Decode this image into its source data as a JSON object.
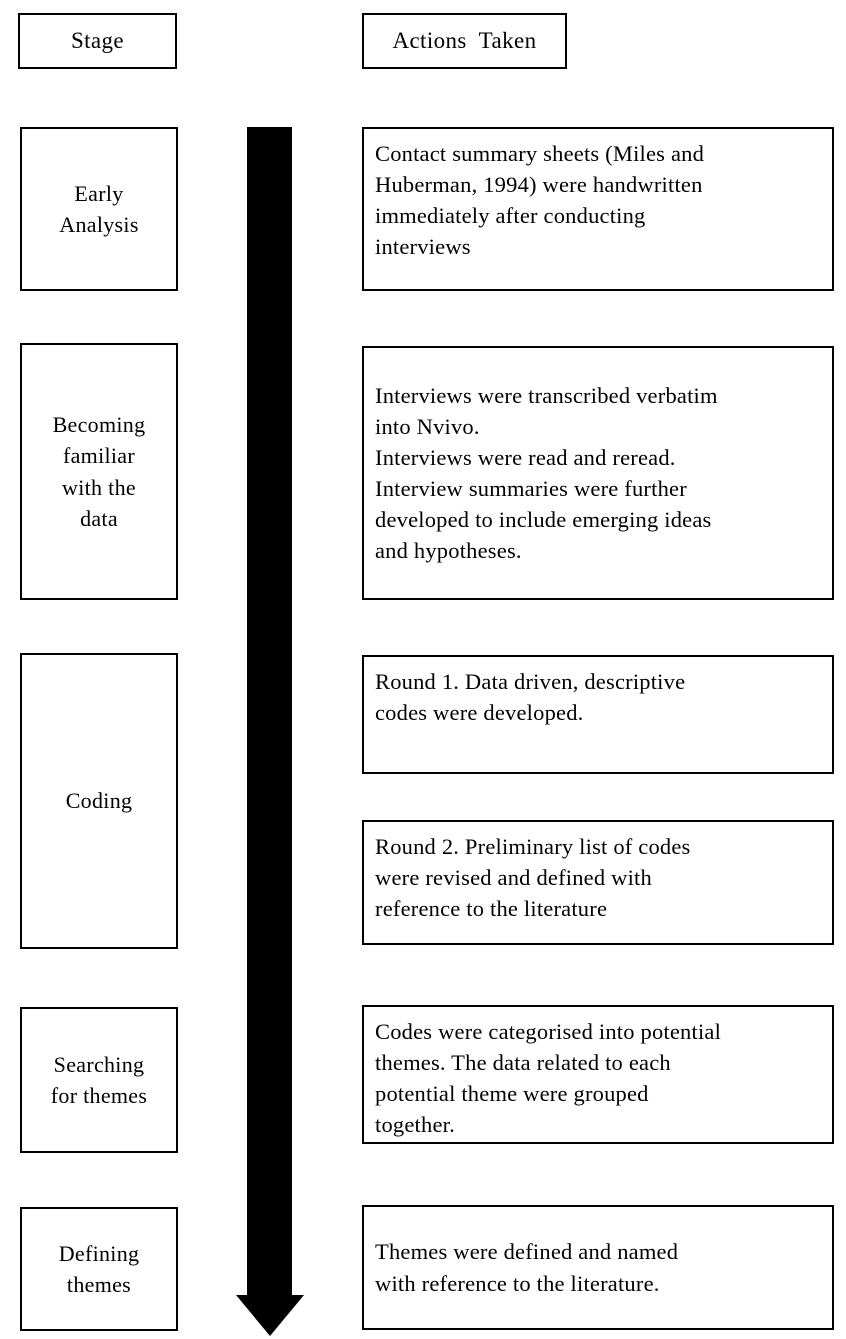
{
  "figure": {
    "type": "flow-diagram",
    "orientation": "vertical",
    "columns": [
      {
        "key": "stage",
        "header": "Stage"
      },
      {
        "key": "actions",
        "header": "Actions  Taken"
      }
    ],
    "flow_arrow": {
      "name": "downward-process-arrow",
      "direction": "down",
      "color": "#000000"
    }
  },
  "headers": {
    "stage": "Stage",
    "actions": "Actions  Taken"
  },
  "stages": [
    {
      "id": "early-analysis",
      "label": "Early\nAnalysis"
    },
    {
      "id": "becoming-familiar",
      "label": "Becoming\nfamiliar\nwith  the\ndata"
    },
    {
      "id": "coding",
      "label": "Coding"
    },
    {
      "id": "searching-for-themes",
      "label": "Searching\nfor  themes"
    },
    {
      "id": "defining-themes",
      "label": "Defining\nthemes"
    }
  ],
  "actions": [
    {
      "id": "action-early-analysis",
      "stage": "early-analysis",
      "text": "Contact summary  sheets (Miles  and\nHuberman,  1994) were handwritten\nimmediately  after  conducting\ninterviews"
    },
    {
      "id": "action-becoming-familiar",
      "stage": "becoming-familiar",
      "text": "Interviews  were transcribed  verbatim\ninto  Nvivo.\nInterviews  were read and reread.\nInterview  summaries  were further\ndeveloped  to include  emerging  ideas\nand hypotheses."
    },
    {
      "id": "action-coding-round-1",
      "stage": "coding",
      "text": "Round  1. Data driven,  descriptive\ncodes  were  developed."
    },
    {
      "id": "action-coding-round-2",
      "stage": "coding",
      "text": "Round  2. Preliminary  list  of codes\nwere  revised  and  defined  with\nreference  to the  literature"
    },
    {
      "id": "action-searching-for-themes",
      "stage": "searching-for-themes",
      "text": "Codes were categorised  into  potential\nthemes.  The  data related  to each\npotential  theme  were  grouped\ntogether."
    },
    {
      "id": "action-defining-themes",
      "stage": "defining-themes",
      "text": "Themes  were defined  and named\nwith  reference  to the  literature."
    }
  ]
}
